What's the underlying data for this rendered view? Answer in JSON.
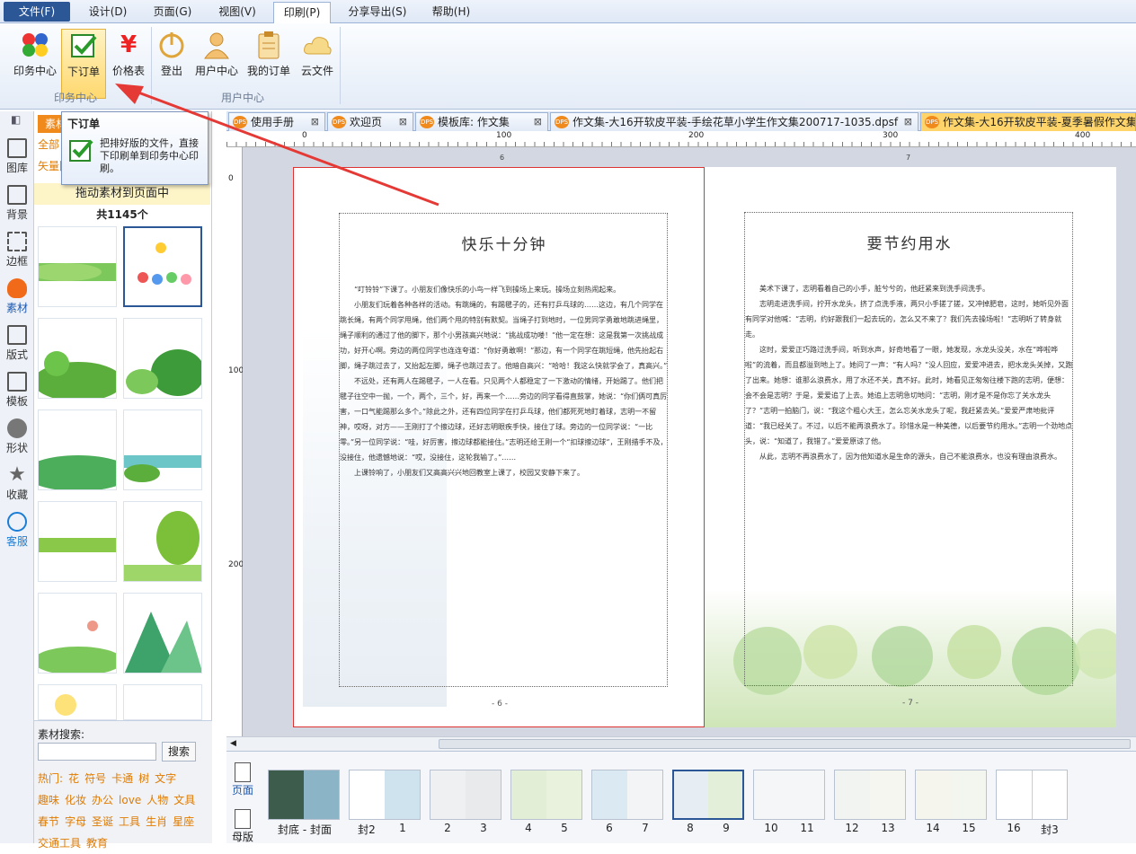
{
  "menu": {
    "file": "文件(F)",
    "design": "设计(D)",
    "page": "页面(G)",
    "view": "视图(V)",
    "print": "印刷(P)",
    "share": "分享导出(S)",
    "help": "帮助(H)"
  },
  "ribbon": {
    "print_center": "印务中心",
    "place_order": "下订单",
    "price_list": "价格表",
    "logout": "登出",
    "user_center": "用户中心",
    "my_orders": "我的订单",
    "cloud_files": "云文件",
    "group_print": "印务中心",
    "group_user": "用户中心"
  },
  "tooltip": {
    "title": "下订单",
    "desc": "把排好版的文件，直接下印刷单到印务中心印刷。"
  },
  "left_tabs": [
    "图库",
    "背景",
    "边框",
    "素材",
    "版式",
    "模板",
    "形状",
    "收藏",
    "客服"
  ],
  "panel": {
    "tab_material": "素材",
    "filter_all": "全部",
    "filter_vector": "矢量图",
    "drag_hint": "拖动素材到页面中",
    "count": "共1145个",
    "search_label": "素材搜索:",
    "search_placeholder": "",
    "search_button": "搜索",
    "hot_label": "热门:",
    "tags_row1": [
      "花",
      "符号",
      "卡通",
      "树",
      "文字"
    ],
    "tags_row2": [
      "趣味",
      "化妆",
      "办公",
      "love",
      "人物",
      "文具"
    ],
    "tags_row3": [
      "春节",
      "字母",
      "圣诞",
      "工具",
      "生肖",
      "星座"
    ],
    "tags_row4": [
      "交通工具",
      "教育"
    ]
  },
  "doc_tabs": [
    "使用手册",
    "欢迎页",
    "模板库: 作文集",
    "作文集-大16开软皮平装-手绘花草小学生作文集200717-1035.dpsf",
    "作文集-大16开软皮平装-夏季暑假作文集"
  ],
  "ruler": {
    "h": [
      "0",
      "100",
      "200",
      "300",
      "400"
    ],
    "v": [
      "0",
      "100",
      "200"
    ],
    "page_marks": [
      "6",
      "7"
    ]
  },
  "left_page": {
    "title": "快乐十分钟",
    "paragraphs": [
      "“叮铃铃”下课了。小朋友们像快乐的小鸟一样飞到操场上来玩。操场立刻热闹起来。",
      "小朋友们玩着各种各样的活动。有跳绳的，有踢毽子的，还有打乒乓球的……这边，有几个同学在跳长绳，有两个同学甩绳，他们两个甩的特别有默契。当绳子打到地时，一位男同学勇敢地跳进绳里，绳子顺利的通过了他的脚下，那个小男孩高兴地说：“挑战成功喽！”他一定在想：这是我第一次挑战成功，好开心啊。旁边的两位同学也连连夸道：“你好勇敢啊！”那边，有一个同学在跳短绳，他先抬起右脚，绳子跳过去了，又抬起左脚，绳子也跳过去了。他暗自高兴：“哈哈！我这么快就学会了，真高兴。”",
      "不远处，还有两人在踢毽子，一人在看。只见两个人都稳定了一下激动的情绪，开始踢了。他们把毽子往空中一抛，一个，两个，三个，好，再来一个……旁边的同学看得直鼓掌，她说：“你们俩可真厉害，一口气能踢那么多个。”除此之外，还有四位同学在打乒乓球，他们都死死地盯着球，志明一不留神，哎呀，对方——王刚打了个擦边球，还好志明眼疾手快，接住了球。旁边的一位同学说：“一比零。”另一位同学说：“哇，好厉害，擦边球都能接住。”志明还给王刚一个“扣球擦边球”，王刚措手不及，没接住，他遗憾地说：“哎，没接住，这轮我输了。”……",
      "上课铃响了，小朋友们又高高兴兴地回教室上课了，校园又安静下来了。"
    ],
    "page_no": "- 6 -"
  },
  "right_page": {
    "title": "要节约用水",
    "paragraphs": [
      "美术下课了，志明看着自己的小手，脏兮兮的，他赶紧来到洗手间洗手。",
      "志明走进洗手间，拧开水龙头，挤了点洗手液，两只小手搓了搓，又冲掉肥皂，这时，她听见外面有同学对他喊：“志明，约好跟我们一起去玩的，怎么又不来了？我们先去操场啦！”志明听了转身就走。",
      "这时，爱爱正巧路过洗手间，听到水声，好奇地看了一眼，她发现，水龙头没关，水在“哗啦哗啦”的流着，而且都溢到地上了。她问了一声：“有人吗？”没人回应，爱爱冲进去，把水龙头关掉，又跑了出来。她想：谁那么浪费水，用了水还不关，真不好。此时，她看见正匆匆往楼下跑的志明，便想：会不会是志明？于是，爱爱追了上去。她追上志明急切地问：“志明，刚才是不是你忘了关水龙头了？”志明一拍脑门，说：“我这个粗心大王，怎么忘关水龙头了呢，我赶紧去关。”爱爱严肃地批评道：“我已经关了。不过，以后不能再浪费水了。珍惜水是一种美德，以后要节约用水。”志明一个劲地点头，说：“知道了，我错了。”爱爱原谅了他。",
      "从此，志明不再浪费水了，因为他知道水是生命的源头，自己不能浪费水，也没有理由浪费水。"
    ],
    "page_no": "- 7 -"
  },
  "strip": {
    "side_page": "页面",
    "side_master": "母版",
    "labels": [
      "封底 - 封面",
      "封2",
      "1",
      "2",
      "3",
      "4",
      "5",
      "6",
      "7",
      "8",
      "9",
      "10",
      "11",
      "12",
      "13",
      "14",
      "15",
      "16",
      "封3"
    ]
  },
  "colors": {
    "accent": "#2b5797",
    "active": "#ffd56b",
    "arrow": "#e53935"
  }
}
